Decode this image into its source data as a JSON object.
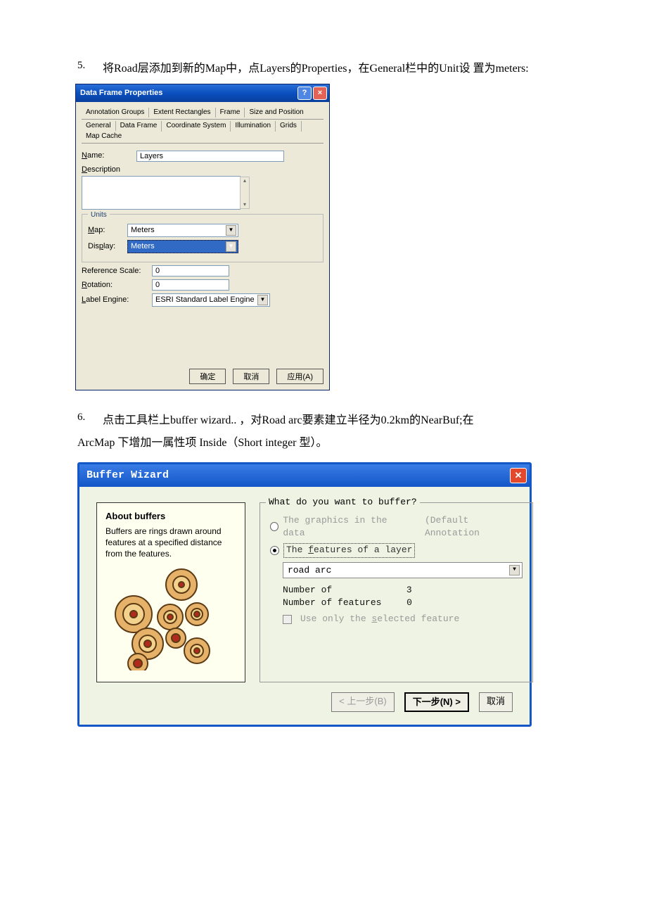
{
  "step5": {
    "num": "5.",
    "text": "将Road层添加到新的Map中，点Layers的Properties，在General栏中的Unit设 置为meters:"
  },
  "dfp": {
    "title": "Data Frame Properties",
    "tabs_row1": [
      "Annotation Groups",
      "Extent Rectangles",
      "Frame",
      "Size and Position"
    ],
    "tabs_row2": [
      "General",
      "Data Frame",
      "Coordinate System",
      "Illumination",
      "Grids",
      "Map Cache"
    ],
    "name_label": "Name:",
    "name_value": "Layers",
    "desc_label": "Description",
    "units_legend": "Units",
    "map_label": "Map:",
    "map_value": "Meters",
    "display_label": "Display:",
    "display_value": "Meters",
    "refscale_label": "Reference Scale:",
    "refscale_value": "0",
    "rotation_label": "Rotation:",
    "rotation_value": "0",
    "labelengine_label": "Label Engine:",
    "labelengine_value": "ESRI Standard Label Engine",
    "ok": "确定",
    "cancel": "取消",
    "apply": "应用(A)"
  },
  "step6": {
    "num": "6.",
    "text1": "点击工具栏上buffer wizard.. ，对Road arc要素建立半径为0.2km的NearBuf;在",
    "text2": "ArcMap 下增加一属性项  Inside（Short integer 型）。"
  },
  "bw": {
    "title": "Buffer Wizard",
    "about_title": "About buffers",
    "about_text": "Buffers are rings drawn around features at a specified distance from the features.",
    "legend": "What do you want to buffer?",
    "opt1": "The graphics in the data",
    "opt1_suffix": "(Default Annotation",
    "opt2": "The features of a layer",
    "layer_value": "road arc",
    "num_of": "Number of",
    "num_of_val": "3",
    "num_feat": "Number of features",
    "num_feat_val": "0",
    "use_sel": "Use only the selected feature",
    "back": "< 上一步(B)",
    "next": "下一步(N) >",
    "cancel": "取消"
  }
}
